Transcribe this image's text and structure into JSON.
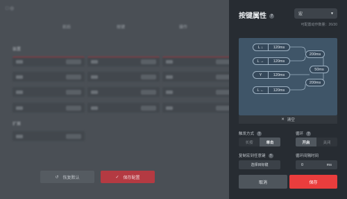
{
  "background": {
    "top_icons": "□ ◎",
    "column_headers": [
      "前后",
      "按键",
      "操作"
    ],
    "section_labels": [
      "装置",
      "扩展"
    ],
    "buttons": {
      "gray_label": "恢复默认",
      "red_label": "保存配置"
    }
  },
  "panel": {
    "title": "按键属性",
    "macro_select": "宏",
    "remaining": "可配置动作数量：26/30",
    "sequence": [
      {
        "key": "L ↓",
        "duration": "120ms"
      },
      {
        "key": "L →",
        "duration": "120ms"
      },
      {
        "key": "Y",
        "duration": "120ms"
      },
      {
        "key": "L ←",
        "duration": "120ms"
      }
    ],
    "intervals": [
      "200ms",
      "50ms",
      "200ms"
    ],
    "clear_label": "清空",
    "trigger_mode_label": "触发方式",
    "trigger_options": [
      "长按",
      "单击"
    ],
    "loop_label": "循环",
    "loop_options": [
      "开启",
      "关闭"
    ],
    "copy_label": "复制宏到任意键",
    "select_target_label": "选择目标键",
    "loop_interval_label": "循环间隔时间",
    "loop_interval_value": "0",
    "loop_interval_unit": "ms",
    "cancel_label": "取消",
    "save_label": "保存",
    "accent_color": "#ea3d3d"
  }
}
